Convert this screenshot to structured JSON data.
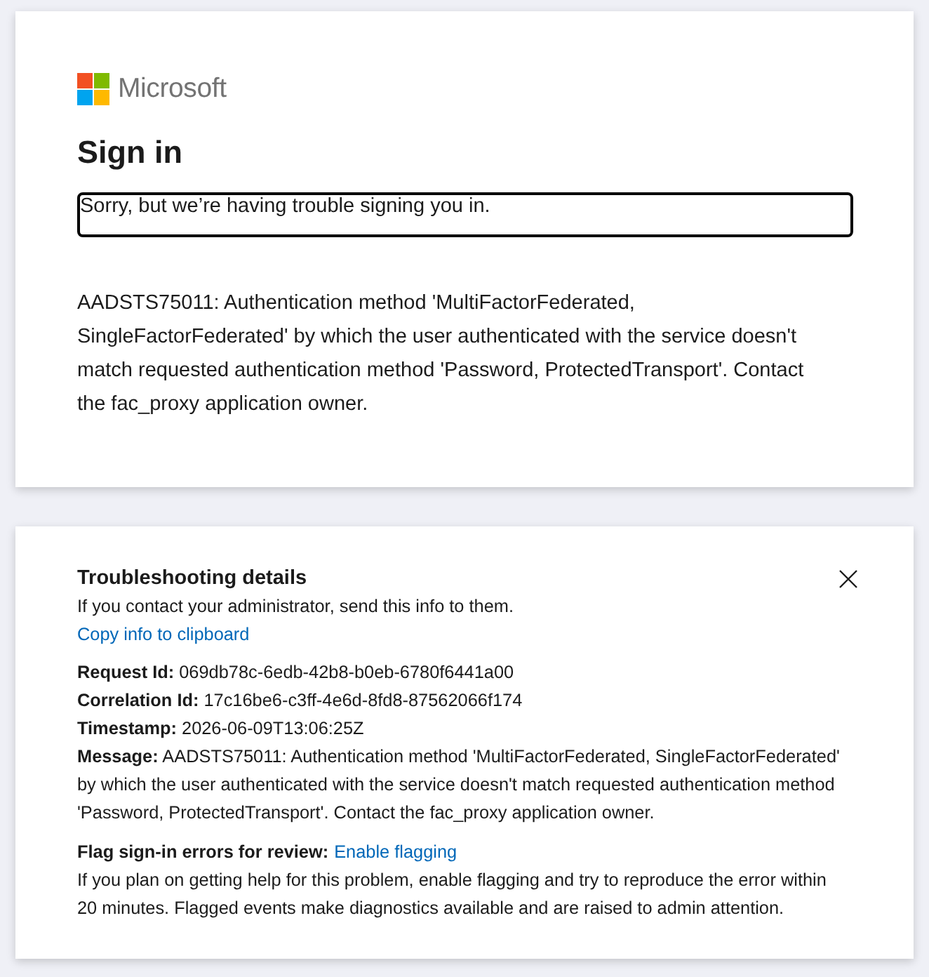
{
  "logo": {
    "wordmark": "Microsoft"
  },
  "heading": "Sign in",
  "alert": {
    "text": "Sorry, but we’re having trouble signing you in."
  },
  "error_description": "AADSTS75011: Authentication method 'MultiFactorFederated, SingleFactorFederated' by which the user authenticated with the service doesn't match requested authentication method 'Password, ProtectedTransport'. Contact the fac_proxy application owner.",
  "troubleshooting": {
    "title": "Troubleshooting details",
    "subtitle": "If you contact your administrator, send this info to them.",
    "copy_link": "Copy info to clipboard",
    "details": [
      "**Request Id:** 069db78c-6edb-42b8-b0eb-6780f6441a00",
      "**Correlation Id:** 17c16be6-c3ff-4e6d-8fd8-87562066f174",
      "**Timestamp:** 2026-06-09T13:06:25Z",
      "**Message:** AADSTS75011: Authentication method 'MultiFactorFederated, SingleFactorFederated' by which the user authenticated with the service doesn't match requested authentication method 'Password, ProtectedTransport'. Contact the fac_proxy application owner."
    ],
    "flagging": {
      "label": "Flag sign-in errors for review:",
      "link": "Enable flagging",
      "description": "If you plan on getting help for this problem, enable flagging and try to reproduce the error within 20 minutes. Flagged events make diagnostics available and are raised to admin attention."
    }
  }
}
